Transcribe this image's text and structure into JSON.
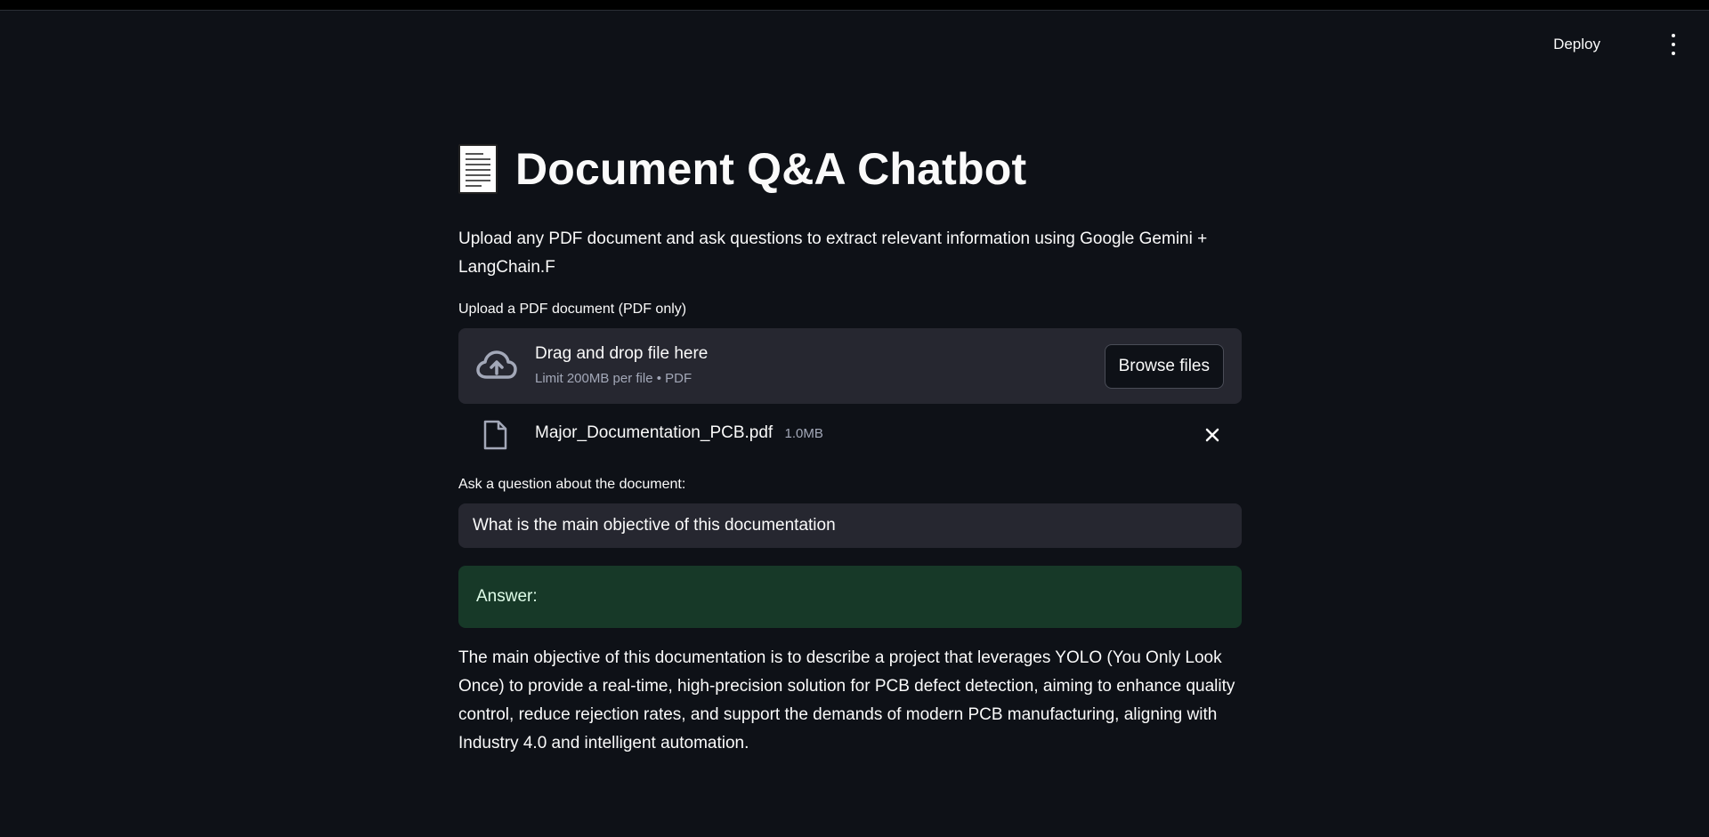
{
  "header": {
    "deploy_label": "Deploy",
    "menu_icon": "more-vertical-icon"
  },
  "main": {
    "title": "Document Q&A Chatbot",
    "title_icon": "page-facing-up-icon",
    "description": "Upload any PDF document and ask questions to extract relevant information using Google Gemini + LangChain.F"
  },
  "uploader": {
    "label": "Upload a PDF document (PDF only)",
    "drop_text": "Drag and drop file here",
    "limit_text": "Limit 200MB per file • PDF",
    "browse_label": "Browse files",
    "icon": "cloud-upload-icon"
  },
  "uploaded_file": {
    "name": "Major_Documentation_PCB.pdf",
    "size": "1.0MB",
    "icon": "file-icon",
    "remove_icon": "close-icon"
  },
  "question": {
    "label": "Ask a question about the document:",
    "value": "What is the main objective of this documentation"
  },
  "answer": {
    "label": "Answer:",
    "text": "The main objective of this documentation is to describe a project that leverages YOLO (You Only Look Once) to provide a real-time, high-precision solution for PCB defect detection, aiming to enhance quality control, reduce rejection rates, and support the demands of modern PCB manufacturing, aligning with Industry 4.0 and intelligent automation."
  },
  "colors": {
    "background": "#0e1117",
    "widget": "#262730",
    "success_bg": "#173928",
    "text": "#fafafa",
    "muted": "#a3a8b8"
  }
}
